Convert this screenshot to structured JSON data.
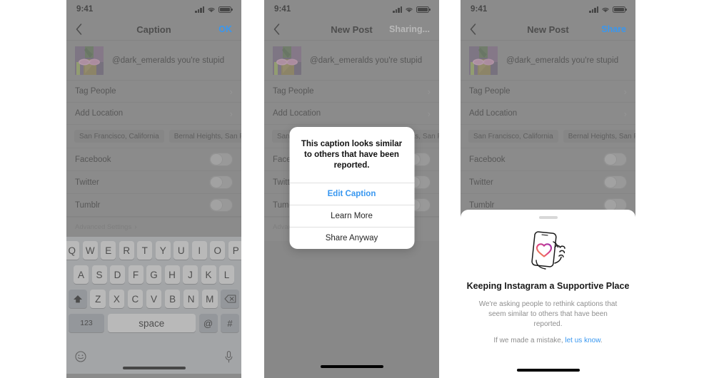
{
  "statusbar": {
    "time": "9:41",
    "signal_icon": "cellular-bars-icon",
    "wifi_icon": "wifi-icon",
    "battery_icon": "battery-icon"
  },
  "panel1": {
    "nav": {
      "back_icon": "chevron-left-icon",
      "title": "Caption",
      "action": "OK"
    },
    "caption": {
      "thumbnail_icon": "post-thumbnail-pineapple-sunglasses",
      "text": "@dark_emeralds you're stupid"
    },
    "rows": [
      {
        "label": "Tag People",
        "chevron": "›"
      },
      {
        "label": "Add Location",
        "chevron": "›"
      }
    ],
    "location_chips": [
      "San Francisco, California",
      "Bernal Heights, San Fra"
    ],
    "toggles": [
      {
        "label": "Facebook",
        "on": false
      },
      {
        "label": "Twitter",
        "on": false
      },
      {
        "label": "Tumblr",
        "on": false
      }
    ],
    "advanced_settings": "Advanced Settings",
    "advanced_chevron": "›",
    "keyboard": {
      "row1": [
        "Q",
        "W",
        "E",
        "R",
        "T",
        "Y",
        "U",
        "I",
        "O",
        "P"
      ],
      "row2": [
        "A",
        "S",
        "D",
        "F",
        "G",
        "H",
        "J",
        "K",
        "L"
      ],
      "row3": [
        "Z",
        "X",
        "C",
        "V",
        "B",
        "N",
        "M"
      ],
      "shift_icon": "shift-key-icon",
      "backspace_icon": "backspace-key-icon",
      "numbers_key": "123",
      "space_key": "space",
      "at_key": "@",
      "hash_key": "#",
      "emoji_icon": "emoji-key-icon",
      "mic_icon": "microphone-key-icon"
    }
  },
  "panel2": {
    "nav": {
      "back_icon": "chevron-left-icon",
      "title": "New Post",
      "action": "Sharing..."
    },
    "caption": {
      "thumbnail_icon": "post-thumbnail-pineapple-sunglasses",
      "text": "@dark_emeralds you're stupid"
    },
    "rows": [
      {
        "label": "Tag People",
        "chevron": "›"
      },
      {
        "label": "Add Location",
        "chevron": "›"
      }
    ],
    "location_chips": [
      "San Francisco, California",
      "Bernal Heights, San Fra"
    ],
    "toggles": [
      {
        "label": "Facebook",
        "on": false
      },
      {
        "label": "Twitter",
        "on": false
      },
      {
        "label": "Tumblr",
        "on": false
      }
    ],
    "advanced_settings": "Advanced Settings",
    "advanced_chevron": "›",
    "alert": {
      "message": "This caption looks similar to others that have been reported.",
      "buttons": [
        {
          "label": "Edit Caption",
          "style": "primary"
        },
        {
          "label": "Learn More",
          "style": "default"
        },
        {
          "label": "Share Anyway",
          "style": "default"
        }
      ]
    }
  },
  "panel3": {
    "nav": {
      "back_icon": "chevron-left-icon",
      "title": "New Post",
      "action": "Share"
    },
    "caption": {
      "thumbnail_icon": "post-thumbnail-pineapple-sunglasses",
      "text": "@dark_emeralds you're stupid"
    },
    "rows": [
      {
        "label": "Tag People",
        "chevron": "›"
      },
      {
        "label": "Add Location",
        "chevron": "›"
      }
    ],
    "location_chips": [
      "San Francisco, California",
      "Bernal Heights, San Fra"
    ],
    "toggles": [
      {
        "label": "Facebook",
        "on": false
      },
      {
        "label": "Twitter",
        "on": false
      },
      {
        "label": "Tumblr",
        "on": false
      }
    ],
    "sheet": {
      "grabber_icon": "sheet-grabber-icon",
      "illustration_icon": "hand-holding-phone-heart-icon",
      "title": "Keeping Instagram a Supportive Place",
      "subtitle": "We're asking people to rethink captions that seem similar to others that have been reported.",
      "footer_prefix": "If we made a mistake, ",
      "footer_link": "let us know",
      "footer_suffix": "."
    }
  },
  "colors": {
    "accent_blue": "#3897f0",
    "screen_gray": "#9a9a9a",
    "keyboard_gray": "#ced2d8",
    "text_primary": "#262626",
    "text_muted": "#8e8e8e"
  }
}
